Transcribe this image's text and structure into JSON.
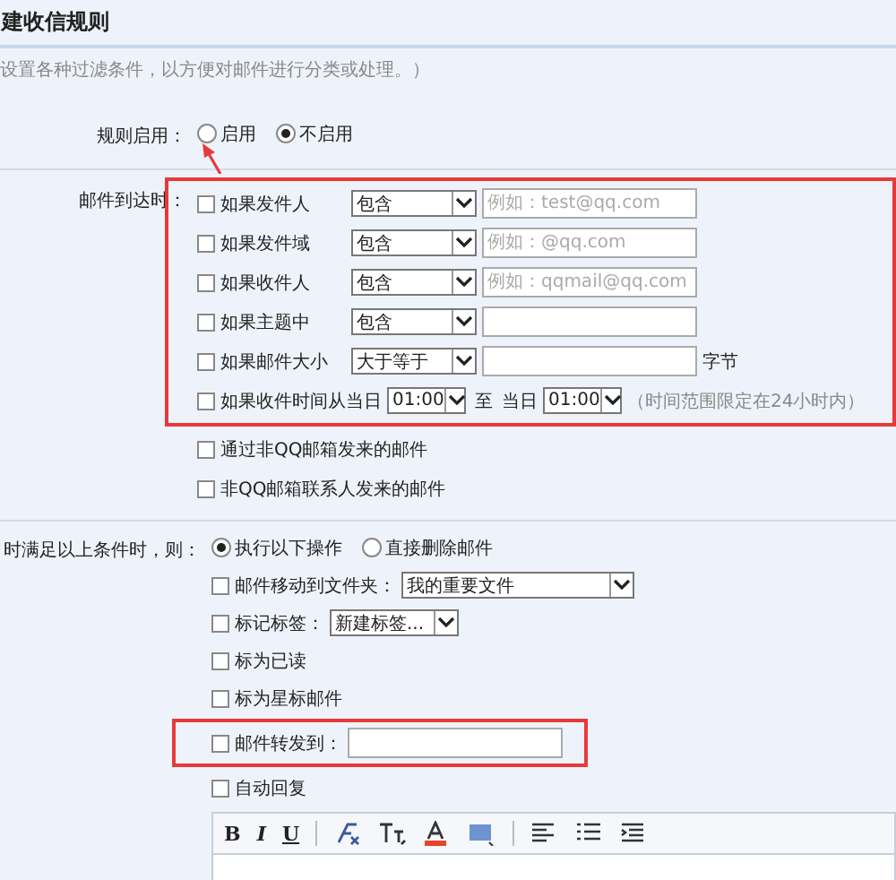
{
  "title": "建收信规则",
  "subtitle": "设置各种过滤条件，以方便对邮件进行分类或处理。）",
  "enable": {
    "label": "规则启用：",
    "options": [
      {
        "label": "启用",
        "selected": false,
        "pointer_arrow": true
      },
      {
        "label": "不启用",
        "selected": true,
        "pointer_arrow": false
      }
    ]
  },
  "conditions": {
    "label": "邮件到达时：",
    "highlighted": true,
    "items": [
      {
        "kind": "match",
        "checked": false,
        "label": "如果发件人",
        "select": "包含",
        "placeholder": "例如：test@qq.com"
      },
      {
        "kind": "match",
        "checked": false,
        "label": "如果发件域",
        "select": "包含",
        "placeholder": "例如：@qq.com"
      },
      {
        "kind": "match",
        "checked": false,
        "label": "如果收件人",
        "select": "包含",
        "placeholder": "例如：qqmail@qq.com"
      },
      {
        "kind": "match",
        "checked": false,
        "label": "如果主题中",
        "select": "包含"
      },
      {
        "kind": "size",
        "checked": false,
        "label": "如果邮件大小",
        "select": "大于等于",
        "unit": "字节"
      },
      {
        "kind": "time",
        "checked": false,
        "label": "如果收件时间从当日",
        "from": "01:00",
        "to_label": "至",
        "day_label": "当日",
        "to": "01:00",
        "hint": "（时间范围限定在24小时内）"
      }
    ],
    "more_items": [
      {
        "kind": "plain",
        "checked": false,
        "label": "通过非QQ邮箱发来的邮件"
      },
      {
        "kind": "plain",
        "checked": false,
        "label": "非QQ邮箱联系人发来的邮件"
      }
    ]
  },
  "actions": {
    "label": "时满足以上条件时，则：",
    "options": [
      {
        "label": "执行以下操作",
        "selected": true
      },
      {
        "label": "直接删除邮件",
        "selected": false
      }
    ],
    "items": [
      {
        "kind": "folder",
        "checked": false,
        "label": "邮件移动到文件夹：",
        "select": "我的重要文件",
        "highlighted": false
      },
      {
        "kind": "tag",
        "checked": false,
        "label": "标记标签：",
        "select": "新建标签...",
        "highlighted": false
      },
      {
        "kind": "plain",
        "checked": false,
        "label": "标为已读",
        "highlighted": false
      },
      {
        "kind": "plain",
        "checked": false,
        "label": "标为星标邮件",
        "highlighted": false
      },
      {
        "kind": "forward",
        "checked": false,
        "label": "邮件转发到：",
        "highlighted": true
      },
      {
        "kind": "plain",
        "checked": false,
        "label": "自动回复",
        "highlighted": false
      }
    ]
  },
  "editor": {
    "toolbar": [
      {
        "kind": "bold",
        "label": "B"
      },
      {
        "kind": "italic",
        "label": "I"
      },
      {
        "kind": "underline",
        "label": "U"
      },
      {
        "kind": "sep"
      },
      {
        "kind": "clear"
      },
      {
        "kind": "size"
      },
      {
        "kind": "color"
      },
      {
        "kind": "bg"
      },
      {
        "kind": "sep"
      },
      {
        "kind": "align"
      },
      {
        "kind": "list"
      },
      {
        "kind": "indent"
      }
    ]
  }
}
